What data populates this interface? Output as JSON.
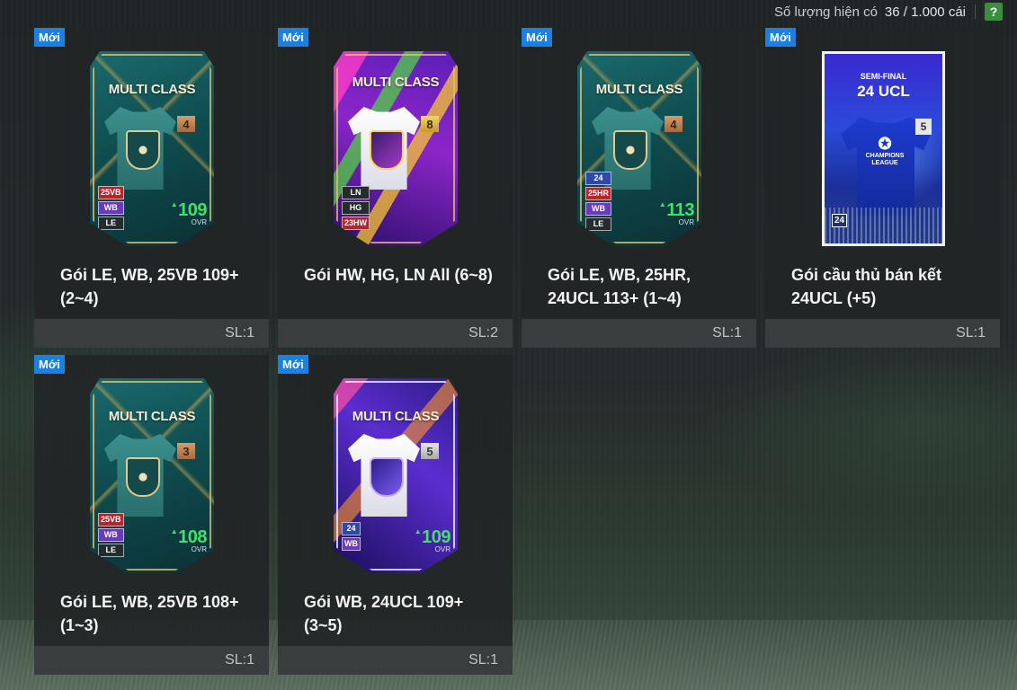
{
  "header": {
    "available_label": "Số lượng hiện có",
    "available_count": "36 / 1.000 cái",
    "help_label": "?"
  },
  "colors": {
    "new_badge": "#1d7fe0",
    "ovr_green": "#42e06a",
    "help_green": "#3d8e3c",
    "footer_bg": "#393d3e"
  },
  "packs": [
    {
      "new_label": "Mới",
      "name": "Gói LE, WB, 25VB 109+ (2~4)",
      "qty": "SL:1",
      "card_title": "MULTI CLASS",
      "grade": "4",
      "seasons": [
        "25VB",
        "WB",
        "LE"
      ],
      "ovr": "109",
      "ovr_label": "OVR"
    },
    {
      "new_label": "Mới",
      "name": "Gói HW, HG, LN All (6~8)",
      "qty": "SL:2",
      "card_title": "MULTI CLASS",
      "grade": "8",
      "seasons": [
        "LN",
        "HG",
        "23HW"
      ]
    },
    {
      "new_label": "Mới",
      "name": "Gói LE, WB, 25HR, 24UCL 113+ (1~4)",
      "qty": "SL:1",
      "card_title": "MULTI CLASS",
      "grade": "4",
      "seasons": [
        "24",
        "25HR",
        "WB",
        "LE"
      ],
      "ovr": "113",
      "ovr_label": "OVR"
    },
    {
      "new_label": "Mới",
      "name": "Gói cầu thủ bán kết 24UCL (+5)",
      "qty": "SL:1",
      "card_subtitle": "SEMI-FINAL",
      "card_title": "24 UCL",
      "logo_text": "CHAMPIONS LEAGUE",
      "grade": "5",
      "season": "24"
    },
    {
      "new_label": "Mới",
      "name": "Gói LE, WB, 25VB 108+ (1~3)",
      "qty": "SL:1",
      "card_title": "MULTI CLASS",
      "grade": "3",
      "seasons": [
        "25VB",
        "WB",
        "LE"
      ],
      "ovr": "108",
      "ovr_label": "OVR"
    },
    {
      "new_label": "Mới",
      "name": "Gói WB, 24UCL 109+ (3~5)",
      "qty": "SL:1",
      "card_title": "MULTI CLASS",
      "grade": "5",
      "seasons": [
        "24",
        "WB"
      ],
      "ovr": "109",
      "ovr_label": "OVR"
    }
  ]
}
